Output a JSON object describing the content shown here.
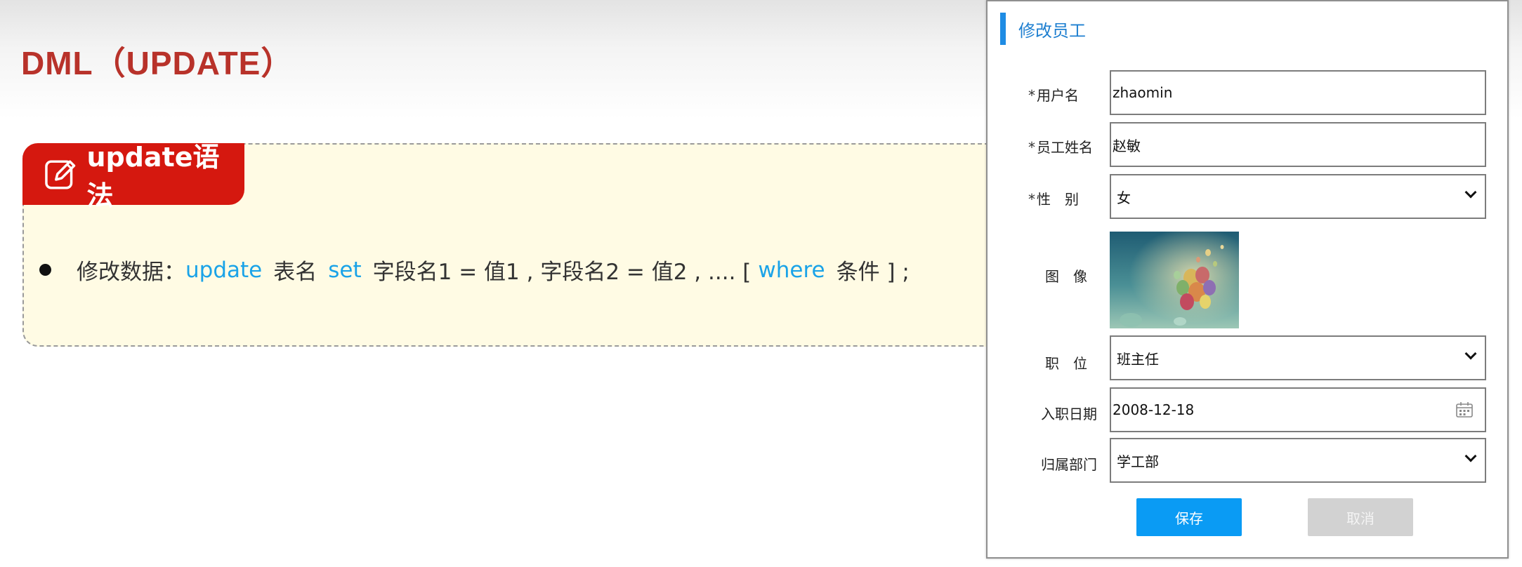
{
  "slide": {
    "title": "DML（UPDATE）",
    "note_tab_label": "update语法",
    "bullet": {
      "prefix": "修改数据：",
      "kw_update": "update",
      "table": "表名",
      "kw_set": "set",
      "assign": "字段名1 = 值1 , 字段名2 = 值2 , .... [",
      "kw_where": "where",
      "cond": "条件 ] ;"
    }
  },
  "dialog": {
    "title": "修改员工",
    "username": {
      "label": "用户名",
      "value": "zhaomin",
      "required": "*"
    },
    "name": {
      "label": "员工姓名",
      "value": "赵敏",
      "required": "*"
    },
    "gender": {
      "label": "性　别",
      "value": "女",
      "required": "*"
    },
    "image": {
      "label": "图　像"
    },
    "position": {
      "label": "职　位",
      "value": "班主任"
    },
    "entry_date": {
      "label": "入职日期",
      "value": "2008-12-18"
    },
    "department": {
      "label": "归属部门",
      "value": "学工部"
    },
    "save_label": "保存",
    "cancel_label": "取消"
  },
  "colors": {
    "title_red": "#b8322a",
    "tab_red": "#d5180f",
    "keyword_blue": "#1aa3e8",
    "primary_button": "#0a9bf4",
    "disabled_button": "#d2d2d2"
  },
  "icons": [
    "edit-icon",
    "chevron-down-icon",
    "calendar-icon"
  ]
}
